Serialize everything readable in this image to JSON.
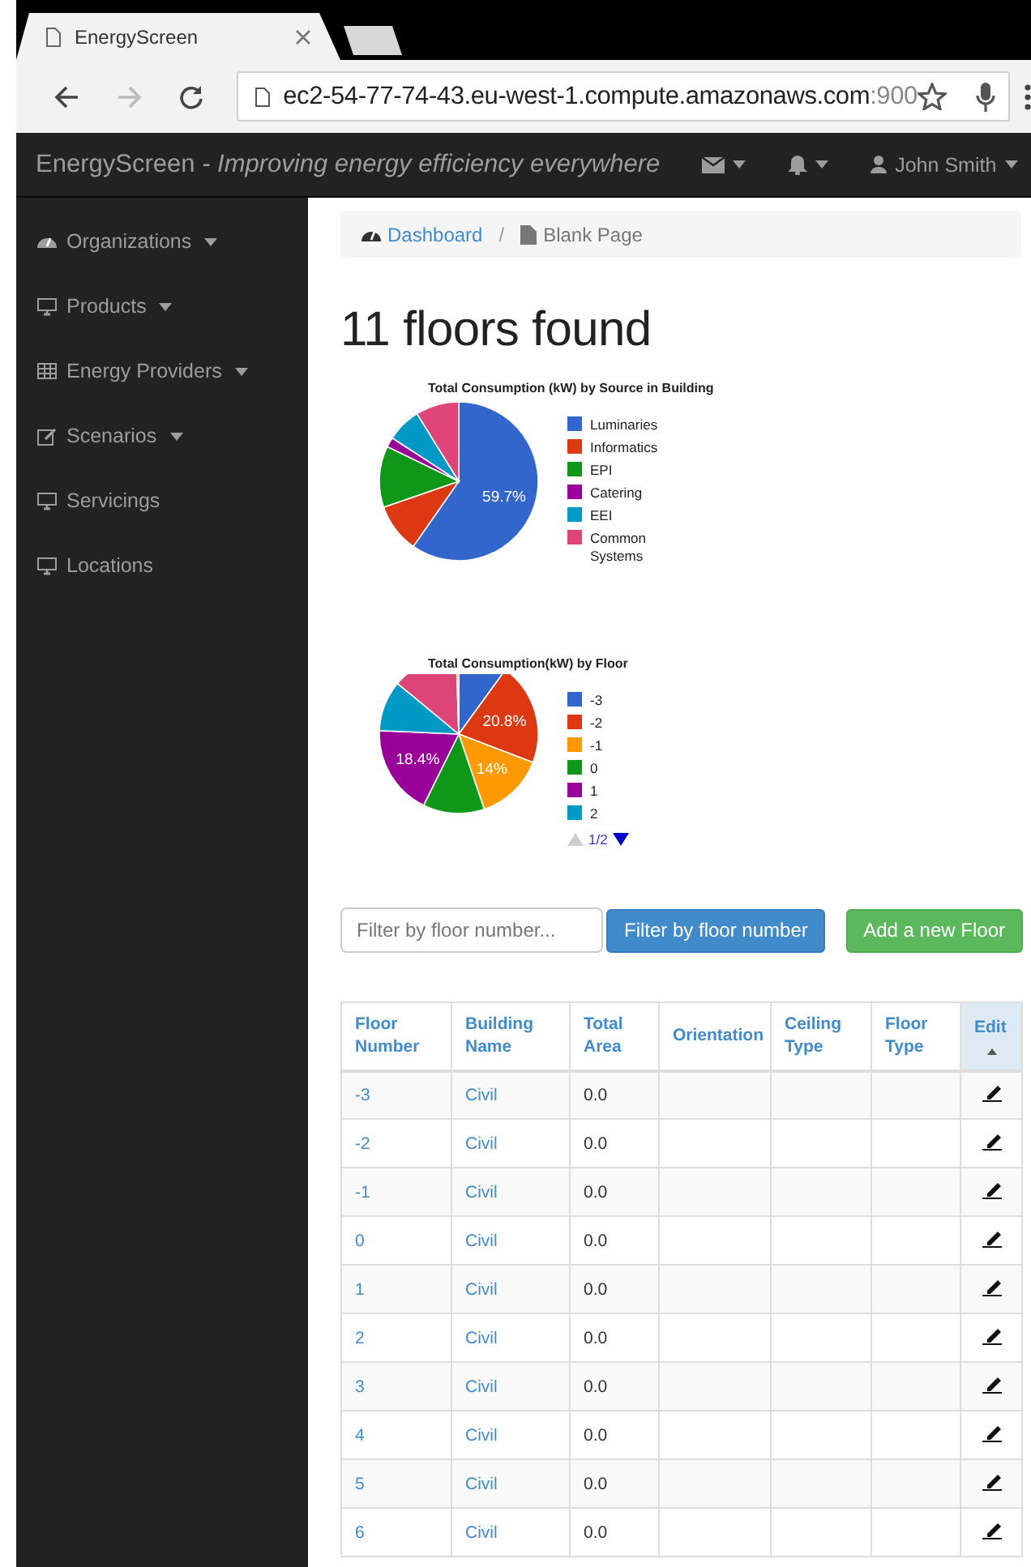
{
  "browser": {
    "tab_title": "EnergyScreen",
    "url_host": "ec2-54-77-74-43.eu-west-1.compute.amazonaws.com",
    "url_port": ":900",
    "forward_disabled": true
  },
  "navbar": {
    "brand": "EnergyScreen",
    "tagline": " - Improving energy efficiency everywhere",
    "user": "John Smith"
  },
  "sidebar": {
    "items": [
      {
        "label": "Organizations",
        "has_dropdown": true
      },
      {
        "label": "Products",
        "has_dropdown": true
      },
      {
        "label": "Energy Providers",
        "has_dropdown": true
      },
      {
        "label": "Scenarios",
        "has_dropdown": true
      },
      {
        "label": "Servicings",
        "has_dropdown": false
      },
      {
        "label": "Locations",
        "has_dropdown": false
      }
    ]
  },
  "breadcrumb": [
    {
      "label": "Dashboard",
      "link": true
    },
    {
      "separator": "/",
      "label": "Blank Page",
      "link": false
    }
  ],
  "heading": "11 floors found",
  "charts": [
    {
      "chart_data": {
        "type": "pie",
        "title": "Total Consumption (kW) by Source in Building",
        "categories": [
          "Luminaries",
          "Informatics",
          "EPI",
          "Catering",
          "EEI",
          "Common Systems"
        ],
        "colors": [
          "#3366cc",
          "#dc3912",
          "#109618",
          "#990099",
          "#0099c6",
          "#dd4477"
        ],
        "values": [
          59.7,
          10,
          12.5,
          2,
          7,
          8.8
        ],
        "value_labels": [
          "59.7%",
          null,
          null,
          null,
          null,
          null
        ]
      }
    },
    {
      "chart_data": {
        "type": "pie",
        "title": "Total Consumption(kW) by Floor",
        "categories": [
          "-3",
          "-2",
          "-1",
          "0",
          "1",
          "2",
          null,
          null
        ],
        "colors": [
          "#3366cc",
          "#dc3912",
          "#ff9900",
          "#109618",
          "#990099",
          "#0099c6",
          "#dd4477",
          "#66aa00"
        ],
        "values": [
          10,
          20.8,
          14,
          12.5,
          18.4,
          10.3,
          13.5,
          0.5
        ],
        "value_labels": [
          null,
          "20.8%",
          "14%",
          null,
          "18.4%",
          null,
          null,
          null
        ]
      },
      "legend_pager": {
        "page": "1/2",
        "prev_disabled": true,
        "next_disabled": false
      }
    }
  ],
  "filter": {
    "placeholder": "Filter by floor number...",
    "filter_button": "Filter by floor number",
    "add_button": "Add a new Floor"
  },
  "table": {
    "columns": [
      {
        "label": "Floor Number",
        "sorted": false
      },
      {
        "label": "Building Name",
        "sorted": false
      },
      {
        "label": "Total Area",
        "sorted": false
      },
      {
        "label": "Orientation",
        "sorted": false
      },
      {
        "label": "Ceiling Type",
        "sorted": false
      },
      {
        "label": "Floor Type",
        "sorted": false
      },
      {
        "label": "Edit",
        "sorted": true
      }
    ],
    "rows": [
      {
        "floor_number": "-3",
        "building_name": "Civil",
        "total_area": "0.0"
      },
      {
        "floor_number": "-2",
        "building_name": "Civil",
        "total_area": "0.0"
      },
      {
        "floor_number": "-1",
        "building_name": "Civil",
        "total_area": "0.0"
      },
      {
        "floor_number": "0",
        "building_name": "Civil",
        "total_area": "0.0"
      },
      {
        "floor_number": "1",
        "building_name": "Civil",
        "total_area": "0.0"
      },
      {
        "floor_number": "2",
        "building_name": "Civil",
        "total_area": "0.0"
      },
      {
        "floor_number": "3",
        "building_name": "Civil",
        "total_area": "0.0"
      },
      {
        "floor_number": "4",
        "building_name": "Civil",
        "total_area": "0.0"
      },
      {
        "floor_number": "5",
        "building_name": "Civil",
        "total_area": "0.0"
      },
      {
        "floor_number": "6",
        "building_name": "Civil",
        "total_area": "0.0"
      }
    ]
  }
}
